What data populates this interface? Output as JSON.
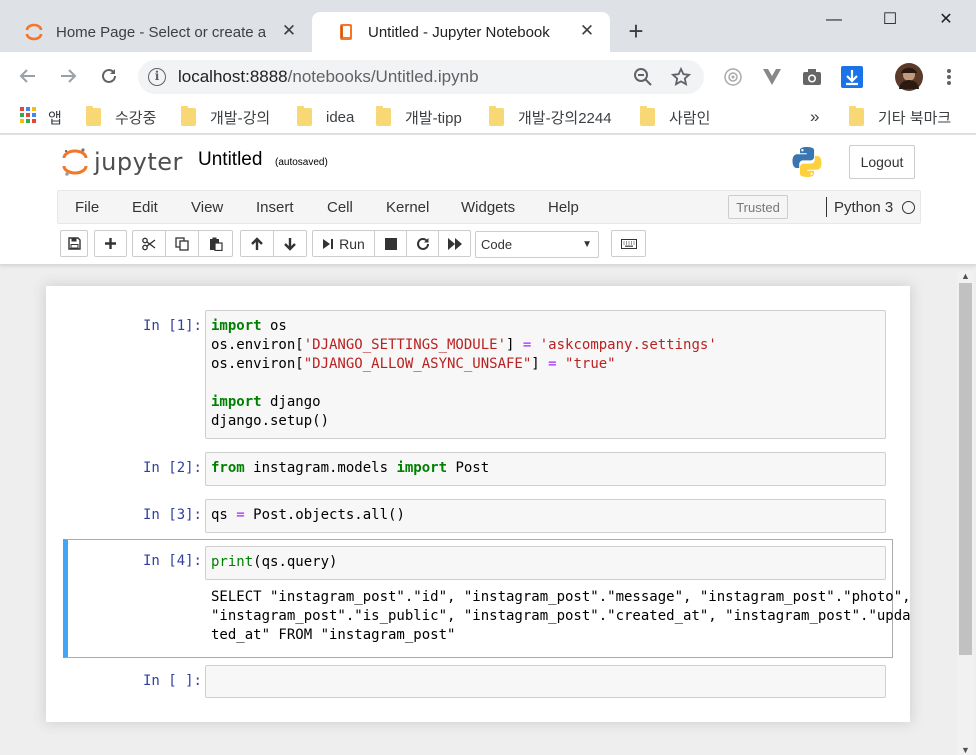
{
  "browser": {
    "tabs": [
      {
        "title": "Home Page - Select or create a notebook",
        "active": false
      },
      {
        "title": "Untitled - Jupyter Notebook",
        "active": true
      }
    ],
    "new_tab_icon": "plus-icon",
    "window_controls": {
      "minimize": "—",
      "maximize": "☐",
      "close": "✕"
    },
    "url_host": "localhost:8888",
    "url_path": "/notebooks/Untitled.ipynb",
    "bookmarks": [
      "앱",
      "수강중",
      "개발-강의",
      "idea",
      "개발-tipp",
      "개발-강의2244",
      "사람인"
    ],
    "bookmarks_overflow": "»",
    "other_bookmarks": "기타 북마크"
  },
  "jupyter": {
    "logo_text": "jupyter",
    "notebook_name": "Untitled",
    "save_status": "(autosaved)",
    "logout_label": "Logout",
    "menu": [
      "File",
      "Edit",
      "View",
      "Insert",
      "Cell",
      "Kernel",
      "Widgets",
      "Help"
    ],
    "trusted_label": "Trusted",
    "kernel_name": "Python 3",
    "run_label": "Run",
    "cell_type": "Code",
    "accent": "#42a5f5",
    "prompt_color": "#303f9f"
  },
  "cells": [
    {
      "prompt": "In [1]:"
    },
    {
      "prompt": "In [2]:"
    },
    {
      "prompt": "In [3]:"
    },
    {
      "prompt": "In [4]:",
      "output": "SELECT \"instagram_post\".\"id\", \"instagram_post\".\"message\", \"instagram_post\".\"photo\",\n\"instagram_post\".\"is_public\", \"instagram_post\".\"created_at\", \"instagram_post\".\"upda\nted_at\" FROM \"instagram_post\""
    },
    {
      "prompt": "In [ ]:"
    }
  ],
  "code": {
    "c1": {
      "l1_kw": "import",
      "l1_rest": " os",
      "l2_a": "os.environ[",
      "l2_s": "'DJANGO_SETTINGS_MODULE'",
      "l2_b": "] ",
      "l2_op": "=",
      "l2_c": " ",
      "l2_s2": "'askcompany.settings'",
      "l3_a": "os.environ[",
      "l3_s": "\"DJANGO_ALLOW_ASYNC_UNSAFE\"",
      "l3_b": "] ",
      "l3_op": "=",
      "l3_c": " ",
      "l3_s2": "\"true\"",
      "l5_kw": "import",
      "l5_rest": " django",
      "l6": "django.setup()"
    },
    "c2": {
      "kw1": "from",
      "mid": " instagram.models ",
      "kw2": "import",
      "rest": " Post"
    },
    "c3": {
      "a": "qs ",
      "op": "=",
      "b": " Post.objects.all()"
    },
    "c4": {
      "fn": "print",
      "rest": "(qs.query)"
    }
  }
}
